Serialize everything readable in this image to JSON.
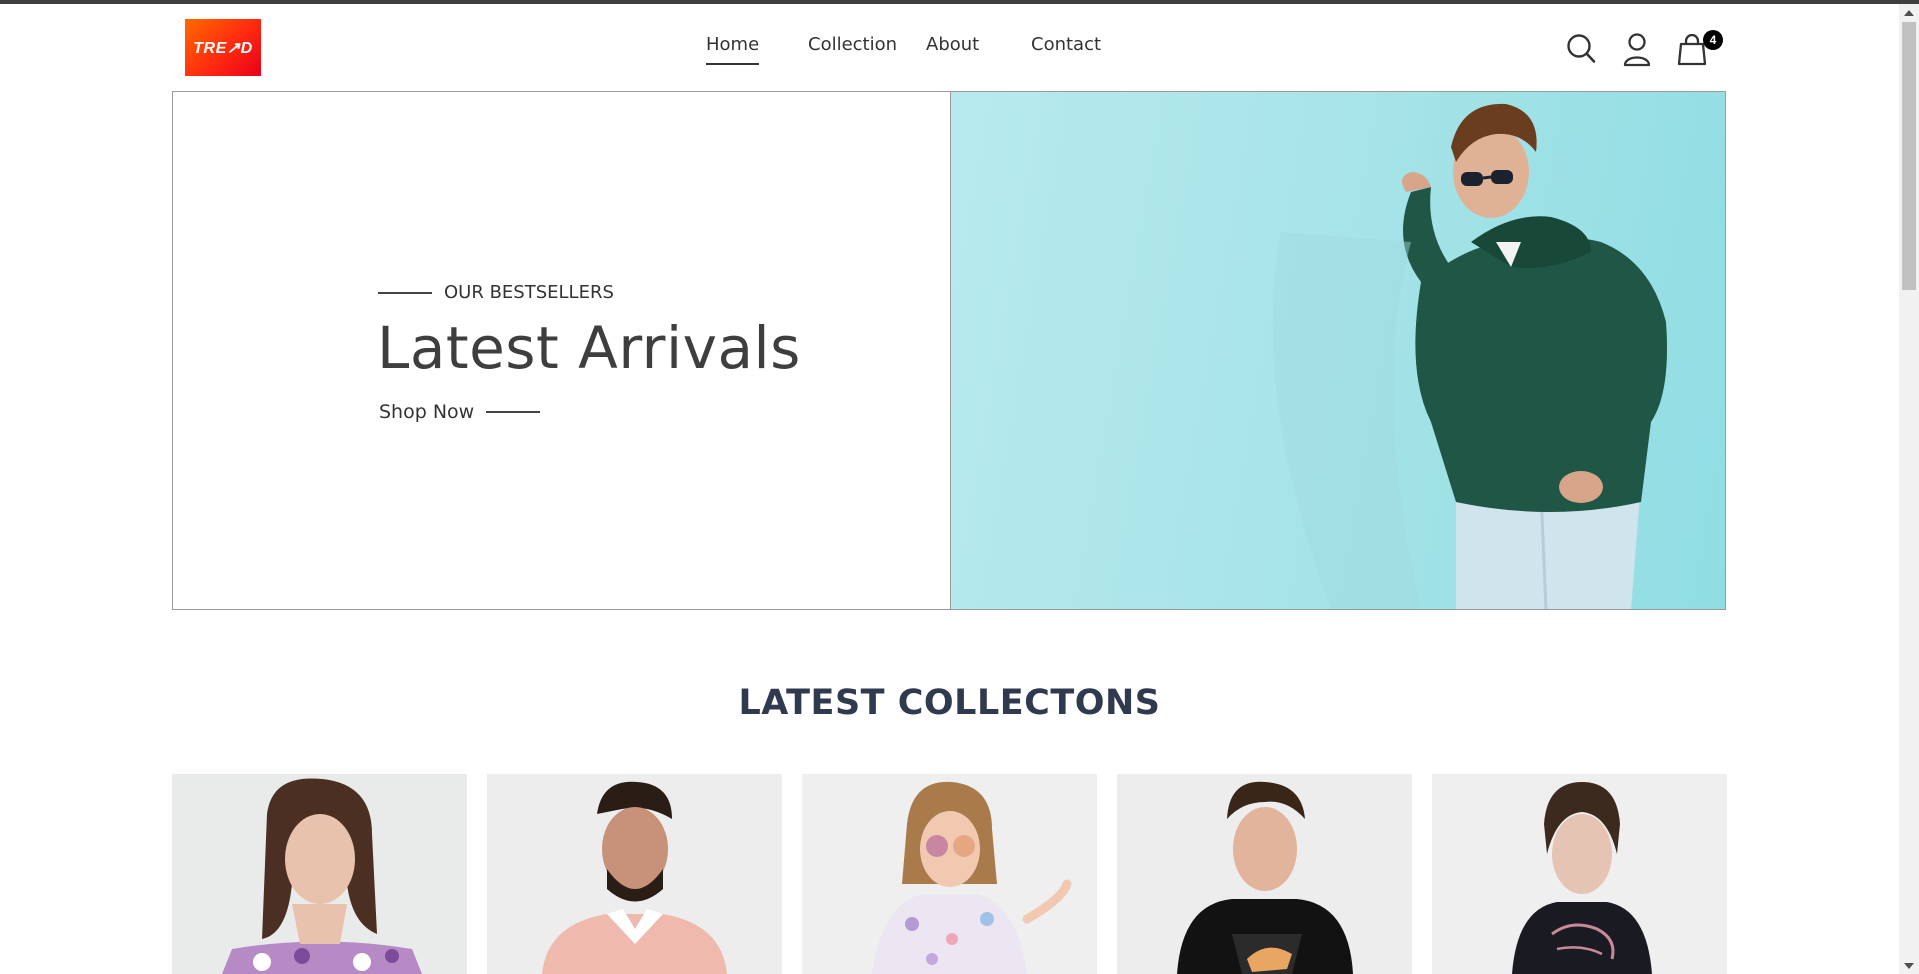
{
  "brand": {
    "logo_text": "TRE↗D",
    "accent": "#ff3a0a"
  },
  "nav": {
    "items": [
      {
        "label": "Home",
        "active": true
      },
      {
        "label": "Collection",
        "active": false
      },
      {
        "label": "About",
        "active": false
      },
      {
        "label": "Contact",
        "active": false
      }
    ]
  },
  "header_icons": {
    "search": "search-icon",
    "account": "user-icon",
    "cart": "shopping-bag-icon",
    "cart_count": "4"
  },
  "hero": {
    "eyebrow": "OUR BESTSELLERS",
    "title": "Latest Arrivals",
    "cta": "Shop Now",
    "image_bg": "#a8e4e8"
  },
  "section": {
    "title": "LATEST COLLECTONS"
  },
  "products": [
    {
      "image": "woman in floral off-shoulder top"
    },
    {
      "image": "man in pink polo shirt"
    },
    {
      "image": "girl in floral dress with sunglasses"
    },
    {
      "image": "young man in black puma tee"
    },
    {
      "image": "woman in black puma tee"
    }
  ]
}
